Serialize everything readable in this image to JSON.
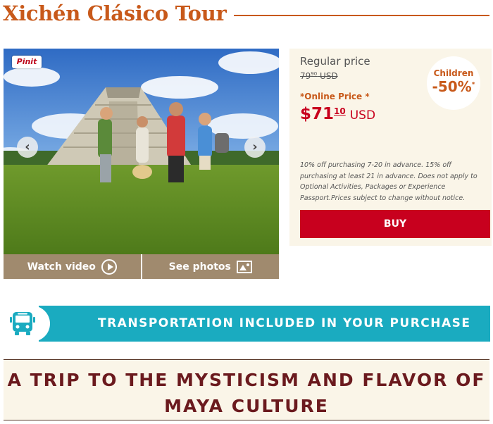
{
  "page": {
    "title": "Xichén Clásico Tour"
  },
  "gallery": {
    "pin_label": "Pinit",
    "prev_icon": "chevron-left-icon",
    "next_icon": "chevron-right-icon",
    "watch_video_label": "Watch video",
    "see_photos_label": "See photos",
    "colors": {
      "media_bar": "#a08a6e"
    }
  },
  "pricing": {
    "regular_label": "Regular price",
    "regular_whole": "79",
    "regular_cents": "90",
    "regular_currency": "USD",
    "online_label": "*Online Price *",
    "online_symbol": "$",
    "online_whole": "71",
    "online_cents": "10",
    "online_currency": "USD",
    "children_label": "Children",
    "children_discount": "-50%",
    "children_mark": "*",
    "fine_print": "10% off purchasing 7-20 in advance. 15% off purchasing at least 21 in advance. Does not apply to Optional Activities, Packages or Experience Passport.Prices subject to change without notice.",
    "buy_label": "BUY",
    "colors": {
      "accent": "#c8591a",
      "buy": "#c8001e",
      "panel": "#faf5e8"
    }
  },
  "transport": {
    "icon": "bus-icon",
    "text": "TRANSPORTATION INCLUDED IN YOUR PURCHASE",
    "color": "#1aabc0"
  },
  "culture": {
    "heading": "A TRIP TO THE MYSTICISM AND FLAVOR OF MAYA CULTURE",
    "color": "#6b1a1e"
  }
}
